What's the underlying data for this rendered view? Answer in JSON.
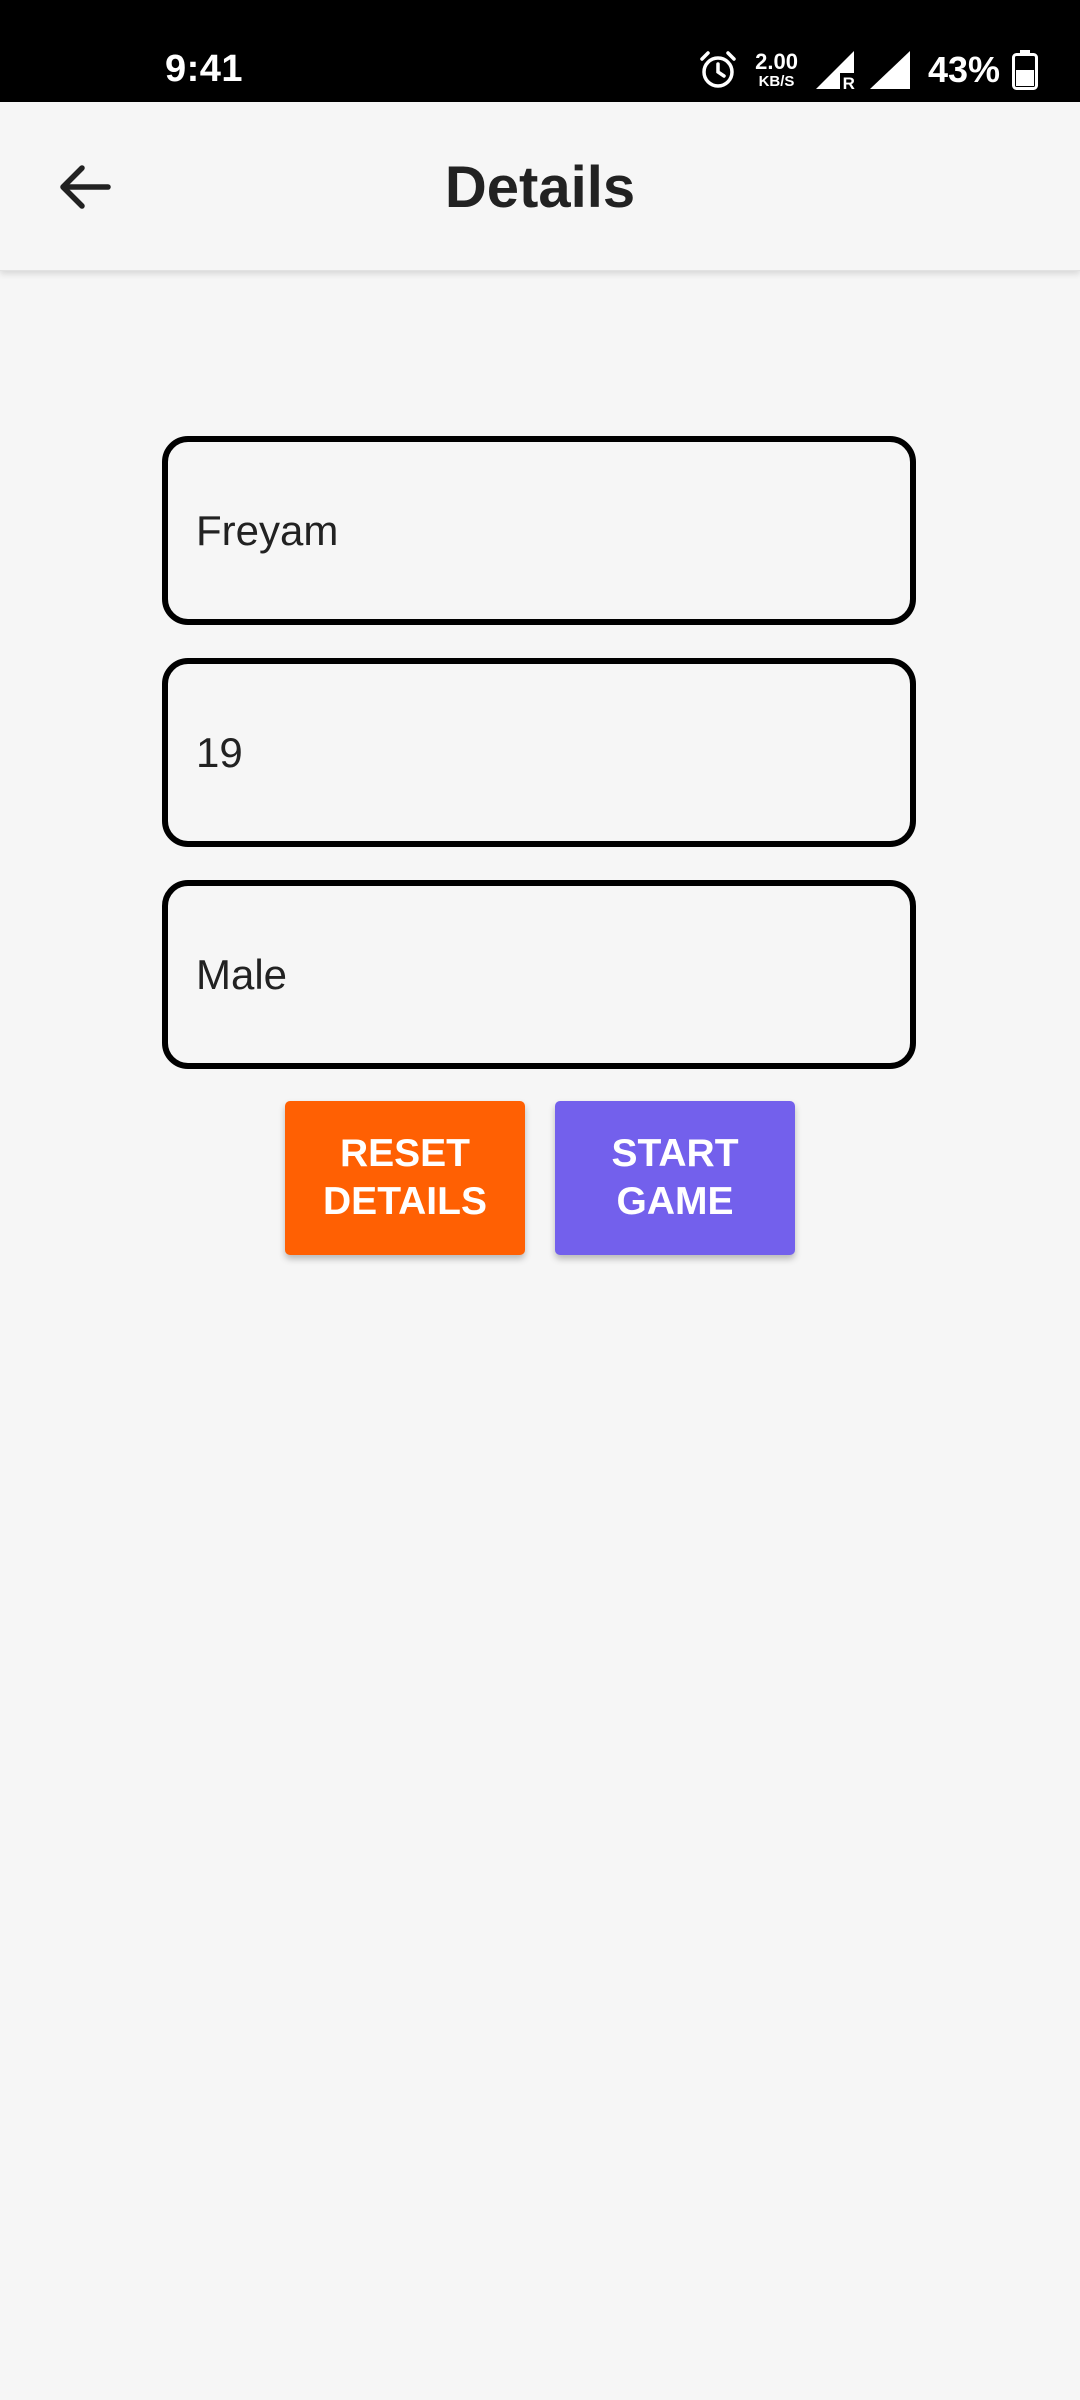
{
  "status_bar": {
    "time": "9:41",
    "net_speed_value": "2.00",
    "net_speed_unit": "KB/S",
    "roaming_indicator": "R",
    "battery_percent": "43%",
    "icons": [
      "alarm-icon",
      "signal-roaming-icon",
      "signal-icon",
      "battery-icon"
    ]
  },
  "app_bar": {
    "back_icon": "arrow-left-icon",
    "title": "Details"
  },
  "form": {
    "name_value": "Freyam",
    "age_value": "19",
    "gender_value": "Male"
  },
  "actions": {
    "reset_label_line1": "RESET",
    "reset_label_line2": "DETAILS",
    "start_label_line1": "START",
    "start_label_line2": "GAME"
  },
  "colors": {
    "status_bar_bg": "#000000",
    "app_bg": "#f6f6f6",
    "reset_button": "#ff6003",
    "start_button": "#7360ec",
    "field_border": "#000000"
  }
}
